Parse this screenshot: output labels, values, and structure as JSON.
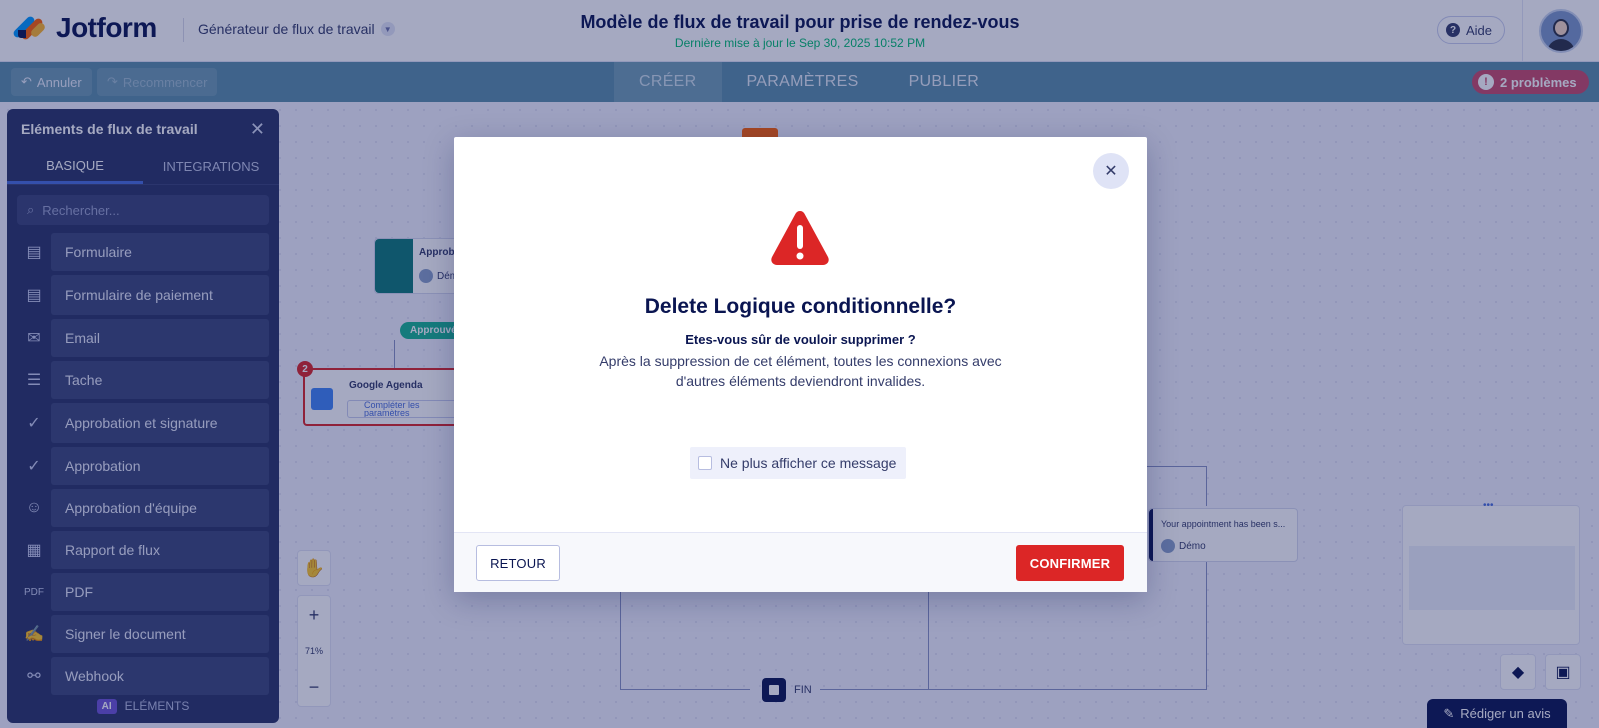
{
  "header": {
    "brand": "Jotform",
    "app_switch": "Générateur de flux de travail",
    "title": "Modèle de flux de travail pour prise de rendez-vous",
    "subtitle": "Dernière mise à jour le Sep 30, 2025 10:52 PM",
    "help": "Aide"
  },
  "toolbar": {
    "undo": "Annuler",
    "redo": "Recommencer",
    "tabs": [
      "CRÉER",
      "PARAMÈTRES",
      "PUBLIER"
    ],
    "problems": "2 problèmes"
  },
  "sidebar": {
    "title": "Eléments de flux de travail",
    "tabs": [
      "BASIQUE",
      "INTEGRATIONS"
    ],
    "search_placeholder": "Rechercher...",
    "items": [
      {
        "label": "Formulaire",
        "icon": "form-icon"
      },
      {
        "label": "Formulaire de paiement",
        "icon": "payment-form-icon"
      },
      {
        "label": "Email",
        "icon": "email-icon"
      },
      {
        "label": "Tache",
        "icon": "task-icon"
      },
      {
        "label": "Approbation et signature",
        "icon": "approval-signature-icon"
      },
      {
        "label": "Approbation",
        "icon": "approval-icon"
      },
      {
        "label": "Approbation d'équipe",
        "icon": "team-approval-icon"
      },
      {
        "label": "Rapport de flux",
        "icon": "flow-report-icon"
      },
      {
        "label": "PDF",
        "icon": "pdf-icon"
      },
      {
        "label": "Signer le document",
        "icon": "sign-document-icon"
      },
      {
        "label": "Webhook",
        "icon": "webhook-icon"
      }
    ],
    "footer_badge": "AI",
    "footer_label": "ELÉMENTS"
  },
  "canvas": {
    "node_approval_title": "Approba",
    "node_approval_assignee": "Dém",
    "approved_pill": "Approuvé",
    "error_count": "2",
    "google_node_title": "Google Agenda",
    "google_node_action": "Compléter les paramètres",
    "email_node_title": "Your appointment has been s...",
    "email_node_assignee": "Démo",
    "zoom_level": "71%",
    "end_label": "FIN",
    "review_button": "Rédiger un avis"
  },
  "modal": {
    "title": "Delete Logique conditionnelle?",
    "question": "Etes-vous sûr de vouloir supprimer ?",
    "description": "Après la suppression de cet élément, toutes les connexions avec d'autres éléments deviendront invalides.",
    "checkbox_label": "Ne plus afficher ce message",
    "back_button": "RETOUR",
    "confirm_button": "CONFIRMER"
  },
  "colors": {
    "brand_navy": "#0a1551",
    "toolbar_teal": "#5b8fa8",
    "danger": "#dc2626",
    "success_green": "#01bd6f"
  }
}
